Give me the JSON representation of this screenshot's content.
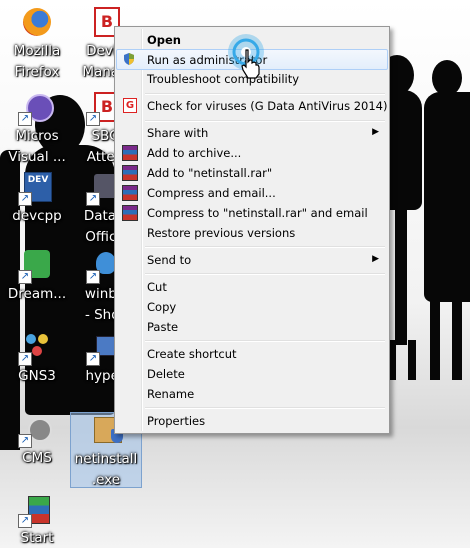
{
  "desktop_icons": [
    {
      "label1": "Mozilla",
      "label2": "Firefox"
    },
    {
      "label1": "Devic",
      "label2": "Manag"
    },
    {
      "label1": "Micros",
      "label2": "Visual ..."
    },
    {
      "label1": "SBC",
      "label2": "Atten"
    },
    {
      "label1": "devcpp",
      "label2": ""
    },
    {
      "label1": "DataN",
      "label2": "Office"
    },
    {
      "label1": "Dream...",
      "label2": ""
    },
    {
      "label1": "winbo",
      "label2": "- Shor"
    },
    {
      "label1": "GNS3",
      "label2": ""
    },
    {
      "label1": "hyper",
      "label2": ""
    },
    {
      "label1": "CMS",
      "label2": ""
    },
    {
      "label1": "netinstall",
      "label2": ".exe"
    },
    {
      "label1": "Start",
      "label2": ""
    }
  ],
  "context_menu": {
    "items": [
      {
        "label": "Open"
      },
      {
        "label": "Run as administrator"
      },
      {
        "label": "Troubleshoot compatibility"
      },
      {
        "label": "Check for viruses (G Data AntiVirus 2014)"
      },
      {
        "label": "Share with"
      },
      {
        "label": "Add to archive..."
      },
      {
        "label": "Add to \"netinstall.rar\""
      },
      {
        "label": "Compress and email..."
      },
      {
        "label": "Compress to \"netinstall.rar\" and email"
      },
      {
        "label": "Restore previous versions"
      },
      {
        "label": "Send to"
      },
      {
        "label": "Cut"
      },
      {
        "label": "Copy"
      },
      {
        "label": "Paste"
      },
      {
        "label": "Create shortcut"
      },
      {
        "label": "Delete"
      },
      {
        "label": "Rename"
      },
      {
        "label": "Properties"
      }
    ],
    "submenu_arrow": "▶"
  },
  "icons": {
    "shield": "uac-shield-icon",
    "gdata": "G",
    "rar": "winrar-icon",
    "shortcut_arrow": "↗"
  },
  "colors": {
    "menu_bg": "#f0f0f0",
    "highlight": "#e3eefb",
    "cursor_ring": "#35a9e8"
  }
}
